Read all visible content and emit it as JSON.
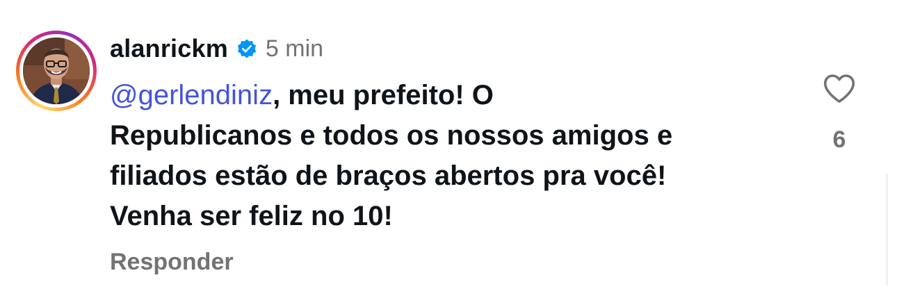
{
  "comment": {
    "username": "alanrickm",
    "verified": true,
    "time": "5 min",
    "mention": "@gerlendiniz",
    "lines": [
      ", meu prefeito! O",
      "Republicanos e todos os nossos amigos e",
      "filiados estão de braços abertos pra você!",
      "Venha ser feliz no 10!"
    ],
    "reply_label": "Responder",
    "like_count": "6"
  },
  "icons": {
    "verified": "verified-badge-icon",
    "like": "heart-outline-icon"
  },
  "colors": {
    "mention": "#4354d9",
    "verified": "#0095f6",
    "muted": "#737373",
    "text": "#0f1419"
  }
}
